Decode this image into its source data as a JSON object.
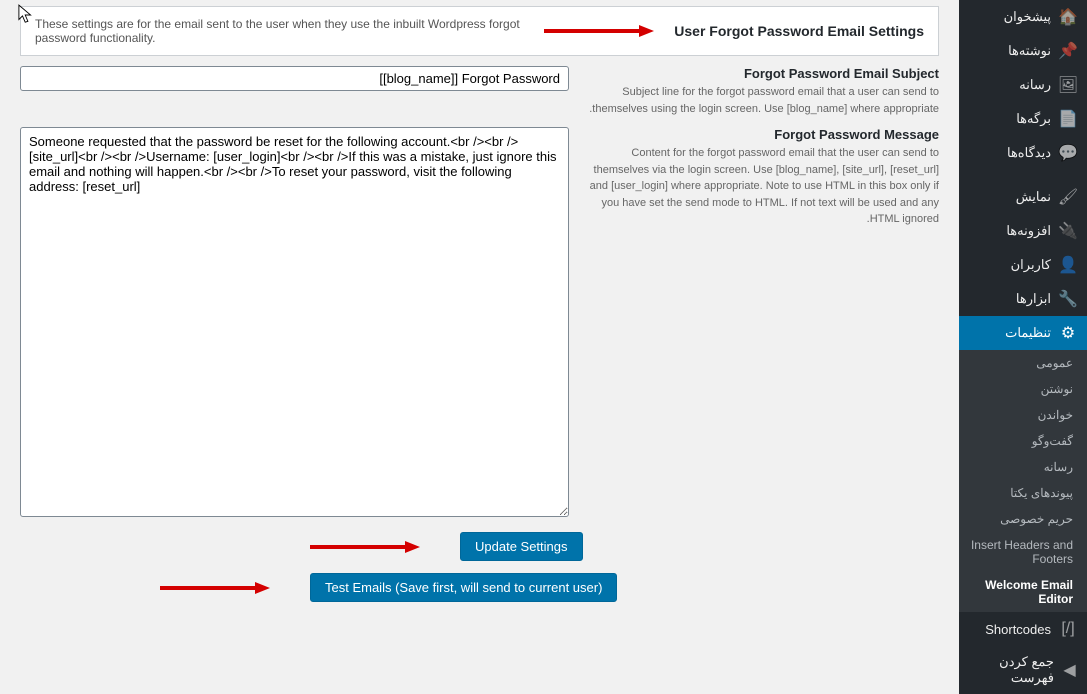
{
  "sidebar": {
    "items": [
      {
        "label": "پیشخوان",
        "icon": "🏠"
      },
      {
        "label": "نوشته‌ها",
        "icon": "📌"
      },
      {
        "label": "رسانه",
        "icon": "🖼"
      },
      {
        "label": "برگه‌ها",
        "icon": "📄"
      },
      {
        "label": "دیدگاه‌ها",
        "icon": "💬"
      },
      {
        "label": "نمایش",
        "icon": "🖌"
      },
      {
        "label": "افزونه‌ها",
        "icon": "🔌"
      },
      {
        "label": "کاربران",
        "icon": "👤"
      },
      {
        "label": "ابزارها",
        "icon": "🔧"
      },
      {
        "label": "تنظیمات",
        "icon": "⚙",
        "active": true
      },
      {
        "label": "Shortcodes",
        "icon": "[/]"
      },
      {
        "label": "جمع کردن فهرست",
        "icon": "◀"
      }
    ],
    "submenu": [
      {
        "label": "عمومی"
      },
      {
        "label": "نوشتن"
      },
      {
        "label": "خواندن"
      },
      {
        "label": "گفت‌وگو"
      },
      {
        "label": "رسانه"
      },
      {
        "label": "پیوندهای یکتا"
      },
      {
        "label": "حریم خصوصی"
      },
      {
        "label": "Insert Headers and Footers"
      },
      {
        "label": "Welcome Email Editor",
        "active": true
      }
    ]
  },
  "section": {
    "title": "User Forgot Password Email Settings",
    "desc": "These settings are for the email sent to the user when they use the inbuilt Wordpress forgot password functionality."
  },
  "subject": {
    "label": "Forgot Password Email Subject",
    "help": "Subject line for the forgot password email that a user can send to themselves using the login screen. Use [blog_name] where appropriate.",
    "value": "[[blog_name]] Forgot Password"
  },
  "message": {
    "label": "Forgot Password Message",
    "help": "Content for the forgot password email that the user can send to themselves via the login screen. Use [blog_name], [site_url], [reset_url] and [user_login] where appropriate. Note to use HTML in this box only if you have set the send mode to HTML. If not text will be used and any HTML ignored.",
    "value": "Someone requested that the password be reset for the following account.<br /><br />[site_url]<br /><br />Username: [user_login]<br /><br />If this was a mistake, just ignore this email and nothing will happen.<br /><br />To reset your password, visit the following address: [reset_url]"
  },
  "buttons": {
    "update": "Update Settings",
    "test": "Test Emails (Save first, will send to current user)"
  }
}
